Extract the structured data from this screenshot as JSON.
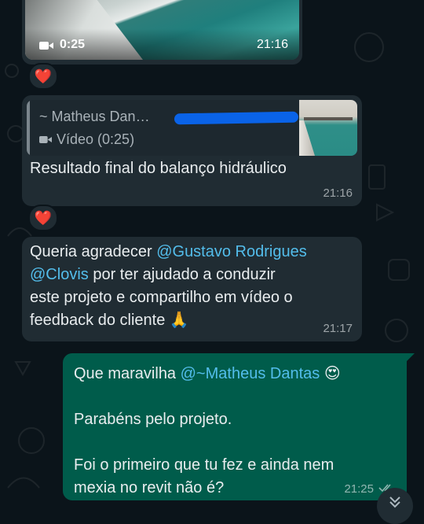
{
  "messages": {
    "video": {
      "duration": "0:25",
      "time": "21:16"
    },
    "reply": {
      "quote_author": "~ Matheus Dan…",
      "quote_label": "Vídeo (0:25)",
      "text": "Resultado final do balanço hidráulico",
      "time": "21:16"
    },
    "thanks": {
      "line1_prefix": "Queria agradecer ",
      "mention1": "@Gustavo Rodrigues",
      "mention2": "@Clovis",
      "line2_rest": " por ter ajudado a conduzir",
      "line3": "este projeto e compartilho em vídeo o",
      "line4": "feedback do cliente",
      "emoji": "🙏",
      "time": "21:17"
    },
    "outgoing": {
      "prefix": "Que maravilha ",
      "mention": "@~Matheus Dantas",
      "emoji": "😍",
      "line2": "Parabéns pelo projeto.",
      "line3": "Foi o primeiro que tu fez e ainda nem",
      "line4": "mexia no revit não é?",
      "time": "21:25"
    }
  },
  "reactions": {
    "first": "❤️",
    "second": "❤️"
  },
  "colors": {
    "background": "#0b141a",
    "incoming_bubble": "#202c33",
    "outgoing_bubble": "#005c4b",
    "mention": "#53bdeb",
    "redaction": "#0a63e8"
  },
  "icons": [
    "video-camera-icon",
    "heart-icon",
    "double-check-icon",
    "chevron-down-icon"
  ]
}
